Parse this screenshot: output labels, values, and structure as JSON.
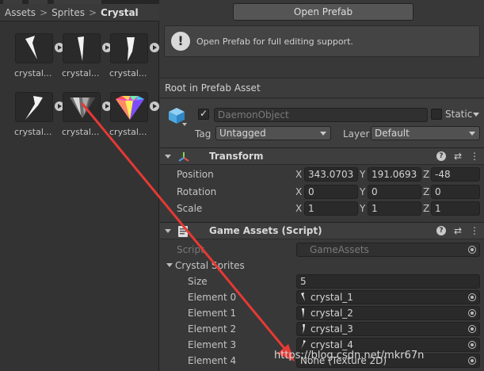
{
  "project_panel": {
    "breadcrumb": [
      "Assets",
      "Sprites",
      "Crystal"
    ],
    "separator": ">",
    "assets": [
      {
        "label": "crystal..."
      },
      {
        "label": "crystal..."
      },
      {
        "label": "crystal..."
      },
      {
        "label": "crystal..."
      },
      {
        "label": "crystal..."
      },
      {
        "label": "crystal..."
      }
    ]
  },
  "inspector": {
    "open_prefab_label": "Open Prefab",
    "help_message": "Open Prefab for full editing support.",
    "help_icon_glyph": "!",
    "root_label": "Root in Prefab Asset",
    "game_object": {
      "name": "DaemonObject",
      "active": true,
      "static_label": "Static",
      "tag_label": "Tag",
      "tag_value": "Untagged",
      "layer_label": "Layer",
      "layer_value": "Default"
    },
    "transform": {
      "title": "Transform",
      "position_label": "Position",
      "rotation_label": "Rotation",
      "scale_label": "Scale",
      "axis_x": "X",
      "axis_y": "Y",
      "axis_z": "Z",
      "position": {
        "x": "343.0703",
        "y": "191.0693",
        "z": "-48"
      },
      "rotation": {
        "x": "0",
        "y": "0",
        "z": "0"
      },
      "scale": {
        "x": "1",
        "y": "1",
        "z": "1"
      }
    },
    "game_assets": {
      "title": "Game Assets (Script)",
      "script_label": "Script",
      "script_value": "GameAssets",
      "array_label": "Crystal Sprites",
      "size_label": "Size",
      "size_value": "5",
      "elements": [
        {
          "label": "Element 0",
          "value": "crystal_1"
        },
        {
          "label": "Element 1",
          "value": "crystal_2"
        },
        {
          "label": "Element 2",
          "value": "crystal_3"
        },
        {
          "label": "Element 3",
          "value": "crystal_4"
        },
        {
          "label": "Element 4",
          "value": "None (Texture 2D)"
        }
      ]
    },
    "header_icons": {
      "help": "?",
      "preset": "⇄",
      "menu": "⋮"
    }
  },
  "watermark": "https://blog.csdn.net/mkr67n",
  "colors": {
    "panel_bg": "#383838",
    "field_bg": "#2a2a2a",
    "arrow": "#e53935",
    "cube": "#4fa8e0"
  },
  "icons": [
    "info-icon",
    "cube-icon",
    "transform-icon",
    "script-icon",
    "help-icon",
    "preset-icon",
    "menu-icon",
    "object-picker-icon",
    "play-icon",
    "fold-icon"
  ]
}
